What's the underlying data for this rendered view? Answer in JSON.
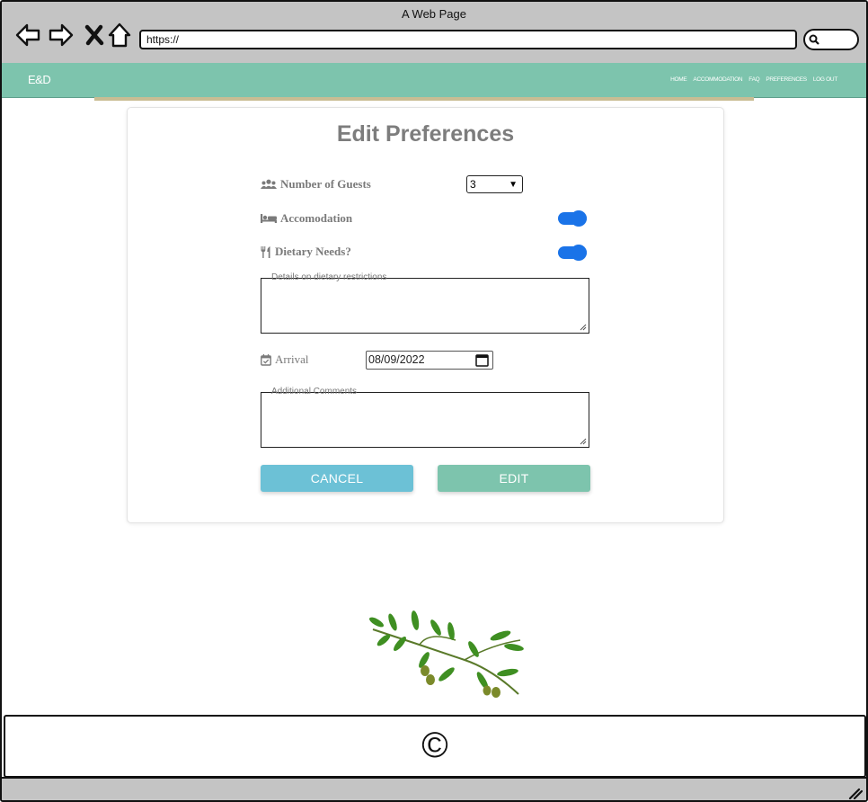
{
  "window": {
    "title": "A Web Page",
    "url": "https://"
  },
  "navbar": {
    "brand": "E&D",
    "links": [
      "HOME",
      "ACCOMMODATION",
      "FAQ",
      "PREFERENCES",
      "LOG OUT"
    ],
    "color": "#7dc4ad"
  },
  "form": {
    "title": "Edit Preferences",
    "guests": {
      "label": "Number of Guests",
      "value": "3"
    },
    "accommodation": {
      "label": "Accomodation",
      "on": true
    },
    "dietary": {
      "label": "Dietary Needs?",
      "on": true
    },
    "dietary_details": {
      "placeholder": "Details on dietary restrictions"
    },
    "arrival": {
      "label": "Arrival",
      "value": "08/09/2022"
    },
    "comments": {
      "placeholder": "Additional Comments"
    },
    "cancel_label": "CANCEL",
    "edit_label": "EDIT",
    "toggle_color": "#1a73e8"
  },
  "footer": {
    "copyright": "©"
  }
}
